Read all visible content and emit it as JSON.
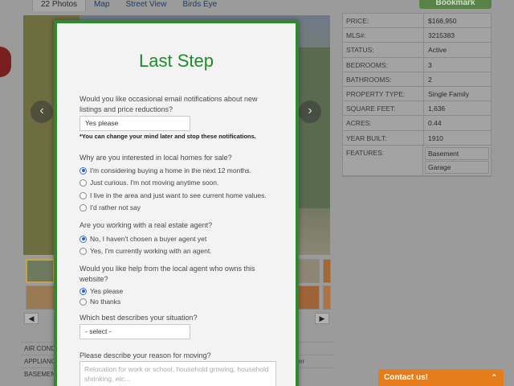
{
  "tabs": [
    "22 Photos",
    "Map",
    "Street View",
    "Birds Eye"
  ],
  "bookmark_label": "Bookmark",
  "gallery": {
    "prev_icon": "‹",
    "next_icon": "›",
    "scroll_left": "◀",
    "scroll_right": "▶"
  },
  "details": [
    {
      "k": "PRICE:",
      "v": "$168,950"
    },
    {
      "k": "MLS#:",
      "v": "3215383"
    },
    {
      "k": "STATUS:",
      "v": "Active"
    },
    {
      "k": "BEDROOMS:",
      "v": "3"
    },
    {
      "k": "BATHROOMS:",
      "v": "2"
    },
    {
      "k": "PROPERTY TYPE:",
      "v": "Single Family"
    },
    {
      "k": "SQUARE FEET:",
      "v": "1,636"
    },
    {
      "k": "ACRES:",
      "v": "0.44"
    },
    {
      "k": "YEAR BUILT:",
      "v": "1910"
    }
  ],
  "features_label": "FEATURES:",
  "features": [
    "Basement",
    "Garage"
  ],
  "lower_table": [
    "AIR CONDI",
    "APPLIANC",
    "BASEMENT"
  ],
  "lower_table_right": "ver",
  "contact": {
    "label": "Contact us!",
    "chevron": "⌃"
  },
  "modal": {
    "title": "Last Step",
    "q1": "Would you like occasional email notifications about new listings and price reductions?",
    "q1_value": "Yes please",
    "q1_note": "*You can change your mind later and stop these notifications.",
    "q2": "Why are you interested in local homes for sale?",
    "q2_options": [
      "I'm considering buying a home in the next 12 months.",
      "Just curious. I'm not moving anytime soon.",
      "I live in the area and just want to see current home values.",
      "I'd rather not say"
    ],
    "q3": "Are you working with a real estate agent?",
    "q3_options": [
      "No, I haven't chosen a buyer agent yet",
      "Yes, I'm currently working with an agent."
    ],
    "q4": "Would you like help from the local agent who owns this website?",
    "q4_options": [
      "Yes please",
      "No thanks"
    ],
    "q5": "Which best describes your situation?",
    "q5_value": "- select -",
    "q6": "Please describe your reason for moving?",
    "q6_placeholder": "Relocation for work or school, household growing, household shrinking, etc..."
  }
}
